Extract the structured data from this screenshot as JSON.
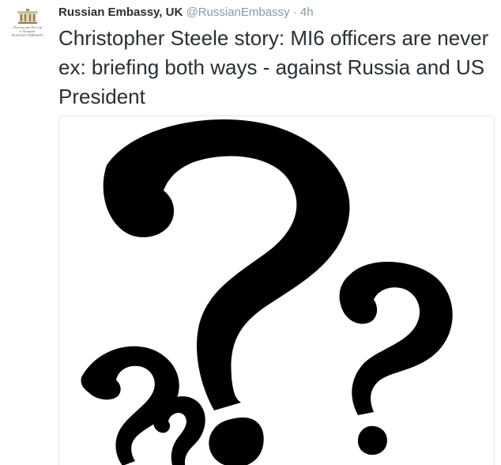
{
  "tweet": {
    "author": {
      "display_name": "Russian Embassy, UK",
      "handle": "@RussianEmbassy",
      "separator": "·",
      "time": "4h"
    },
    "text": "Christopher Steele story: MI6 officers are never ex: briefing both ways - against Russia and US President",
    "media": {
      "icon": "question-marks-illustration"
    }
  }
}
